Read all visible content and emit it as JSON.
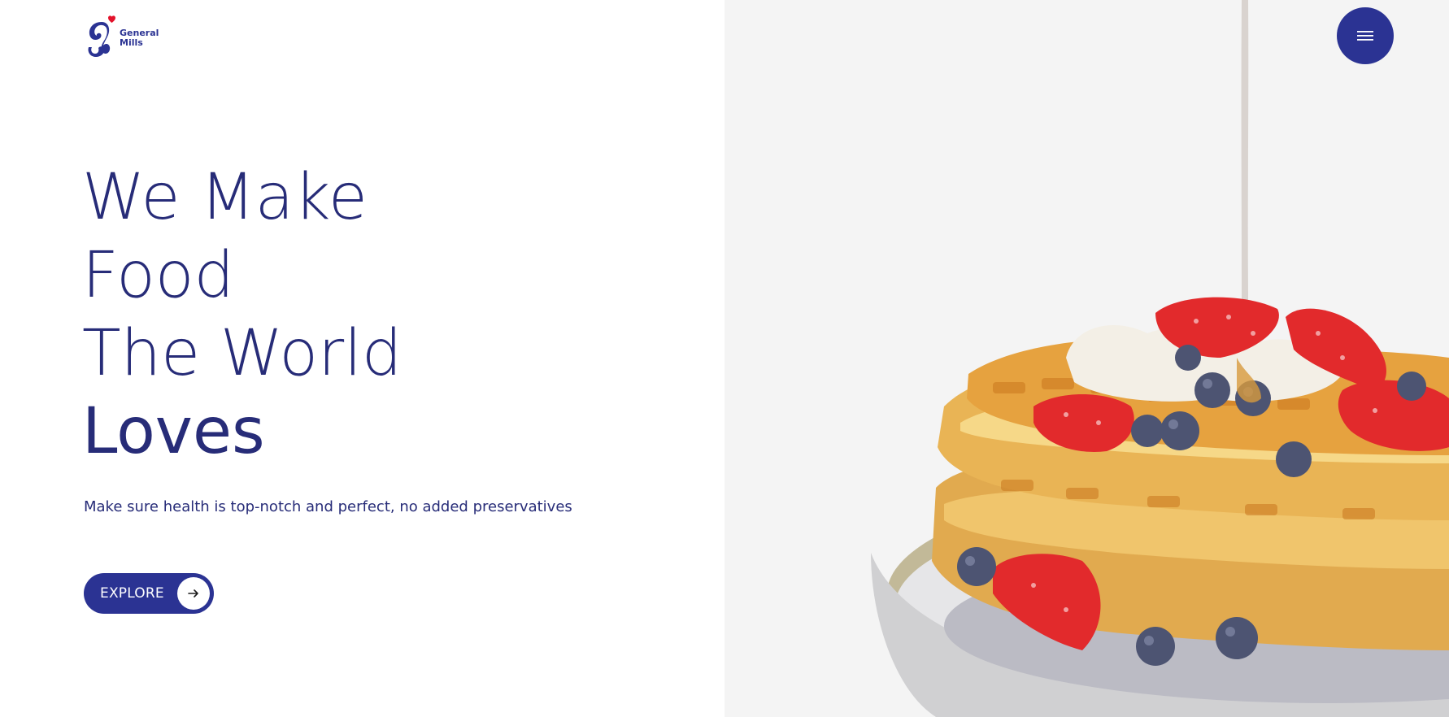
{
  "brand": {
    "line1": "General",
    "line2": "Mills",
    "primary_color": "#2b3393",
    "heart_color": "#e3122b"
  },
  "hero": {
    "headline": [
      "We Make",
      "Food",
      "The World",
      "Loves"
    ],
    "subtitle": "Make sure health is top-notch and perfect, no added preservatives",
    "cta_label": "EXPLORE",
    "cta_icon": "arrow-right-icon"
  },
  "nav": {
    "menu_icon": "hamburger-menu-icon"
  },
  "illustration": {
    "subject": "waffles-with-strawberries-blueberries-and-syrup"
  }
}
